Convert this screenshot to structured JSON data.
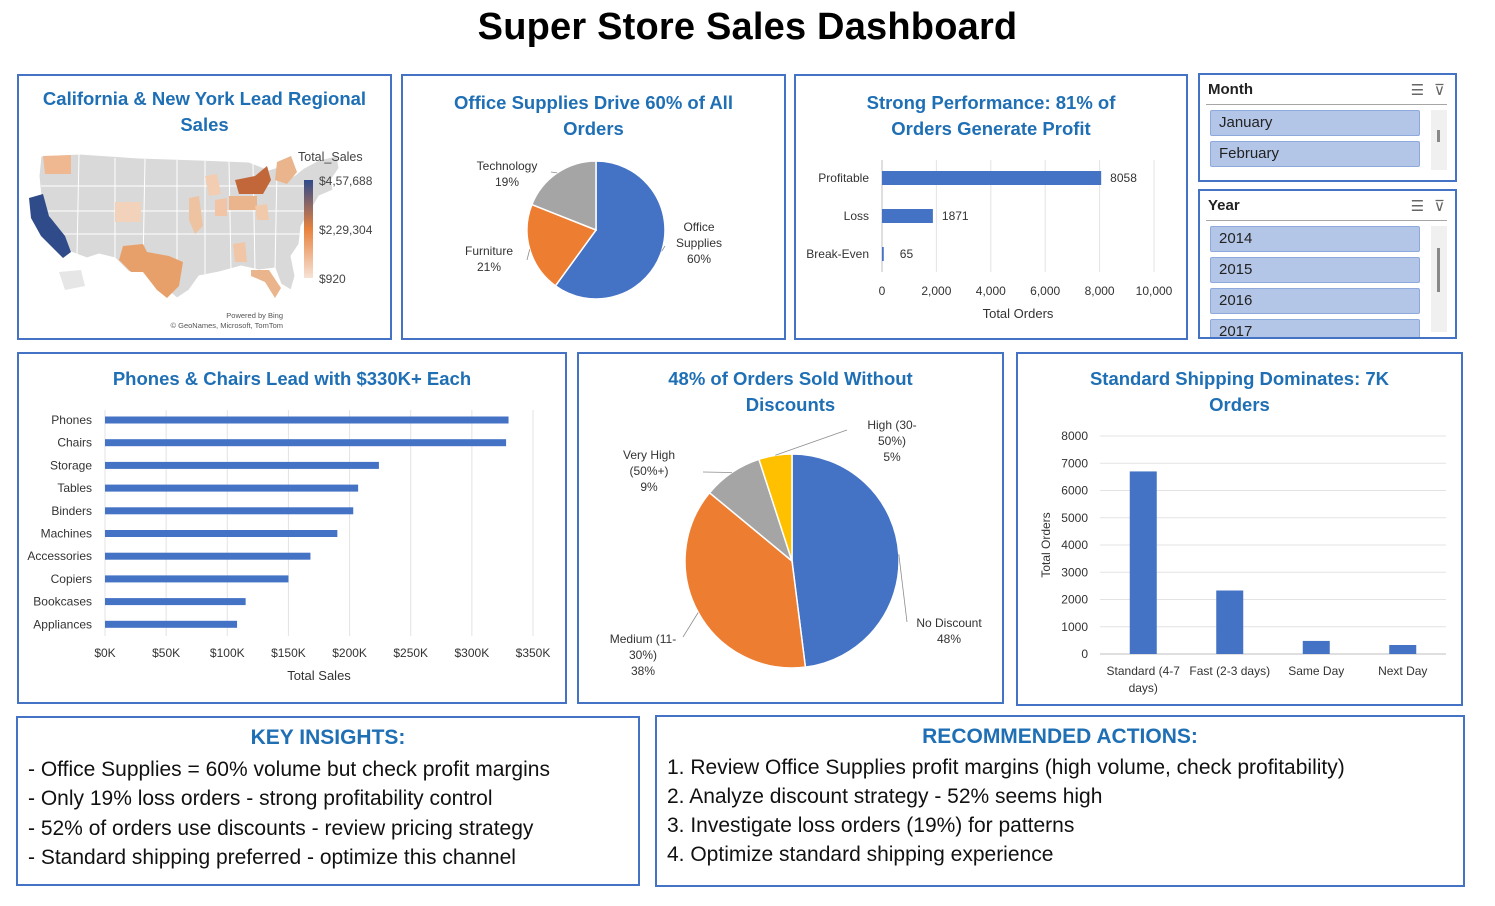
{
  "dashboard": {
    "title": "Super Store Sales Dashboard"
  },
  "map_panel": {
    "title_line1": "California & New York Lead Regional",
    "title_line2": "Sales",
    "legend_title": "Total_Sales",
    "legend_max": "$4,57,688",
    "legend_mid": "$2,29,304",
    "legend_min": "$920",
    "credit_line1": "Powered by Bing",
    "credit_line2": "© GeoNames, Microsoft, TomTom",
    "colors": {
      "high": "#2f4b8a",
      "mid": "#e8823e",
      "low": "#f3dcc8",
      "none": "#d9d9d9"
    }
  },
  "category_panel": {
    "title_line1": "Office Supplies Drive 60% of All",
    "title_line2": "Orders",
    "chart_data": {
      "type": "pie",
      "slices": [
        {
          "label": "Office Supplies",
          "label_lines": [
            "Office",
            "Supplies",
            "60%"
          ],
          "value": 60,
          "color": "#4472c4"
        },
        {
          "label": "Furniture",
          "label_lines": [
            "Furniture",
            "21%"
          ],
          "value": 21,
          "color": "#ed7d31"
        },
        {
          "label": "Technology",
          "label_lines": [
            "Technology",
            "19%"
          ],
          "value": 19,
          "color": "#a5a5a5"
        }
      ]
    }
  },
  "profit_panel": {
    "title_line1": "Strong Performance: 81% of",
    "title_line2": "Orders Generate Profit",
    "chart_data": {
      "type": "bar",
      "orientation": "horizontal",
      "categories": [
        "Profitable",
        "Loss",
        "Break-Even"
      ],
      "values": [
        8058,
        1871,
        65
      ],
      "value_labels": [
        "8058",
        "1871",
        "65"
      ],
      "xlim": [
        0,
        10000
      ],
      "ticks": [
        "0",
        "2,000",
        "4,000",
        "6,000",
        "8,000",
        "10,000"
      ],
      "xlabel": "Total Orders",
      "color": "#4472c4"
    }
  },
  "month_slicer": {
    "header": "Month",
    "items": [
      "January",
      "February"
    ]
  },
  "year_slicer": {
    "header": "Year",
    "items": [
      "2014",
      "2015",
      "2016",
      "2017"
    ]
  },
  "subcat_panel": {
    "title": "Phones & Chairs Lead with $330K+ Each",
    "chart_data": {
      "type": "bar",
      "orientation": "horizontal",
      "categories": [
        "Phones",
        "Chairs",
        "Storage",
        "Tables",
        "Binders",
        "Machines",
        "Accessories",
        "Copiers",
        "Bookcases",
        "Appliances"
      ],
      "values": [
        330000,
        328000,
        224000,
        207000,
        203000,
        190000,
        168000,
        150000,
        115000,
        108000
      ],
      "xlim": [
        0,
        350000
      ],
      "ticks": [
        "$0K",
        "$50K",
        "$100K",
        "$150K",
        "$200K",
        "$250K",
        "$300K",
        "$350K"
      ],
      "xlabel": "Total Sales",
      "color": "#4472c4"
    }
  },
  "discount_panel": {
    "title_line1": "48% of Orders Sold Without",
    "title_line2": "Discounts",
    "chart_data": {
      "type": "pie",
      "slices": [
        {
          "label": "No Discount",
          "label_lines": [
            "No Discount",
            "48%"
          ],
          "value": 48,
          "color": "#4472c4"
        },
        {
          "label": "Medium (11-30%)",
          "label_lines": [
            "Medium (11-",
            "30%)",
            "38%"
          ],
          "value": 38,
          "color": "#ed7d31"
        },
        {
          "label": "Very High (50%+)",
          "label_lines": [
            "Very High",
            "(50%+)",
            "9%"
          ],
          "value": 9,
          "color": "#a5a5a5"
        },
        {
          "label": "High (30-50%)",
          "label_lines": [
            "High (30-",
            "50%)",
            "5%"
          ],
          "value": 5,
          "color": "#ffc000"
        }
      ]
    }
  },
  "shipping_panel": {
    "title_line1": "Standard Shipping Dominates: 7K",
    "title_line2": "Orders",
    "chart_data": {
      "type": "bar",
      "orientation": "vertical",
      "categories": [
        "Standard (4-7 days)",
        "Fast (2-3 days)",
        "Same Day",
        "Next Day"
      ],
      "category_lines": [
        [
          "Standard (4-7",
          "days)"
        ],
        [
          "Fast (2-3 days)"
        ],
        [
          "Same Day"
        ],
        [
          "Next Day"
        ]
      ],
      "values": [
        6700,
        2330,
        480,
        330
      ],
      "ylim": [
        0,
        8000
      ],
      "yticks": [
        "0",
        "1000",
        "2000",
        "3000",
        "4000",
        "5000",
        "6000",
        "7000",
        "8000"
      ],
      "ylabel": "Total Orders",
      "color": "#4472c4"
    }
  },
  "insights": {
    "title": "KEY INSIGHTS:",
    "lines": [
      "- Office Supplies = 60% volume but check profit margins",
      "- Only 19% loss orders - strong profitability control",
      "- 52% of orders use discounts - review pricing strategy",
      "- Standard shipping preferred - optimize this channel"
    ]
  },
  "actions": {
    "title": "RECOMMENDED ACTIONS:",
    "lines": [
      "1. Review Office Supplies profit margins (high volume, check profitability)",
      "2. Analyze discount strategy - 52% seems high",
      "3. Investigate loss orders (19%) for patterns",
      "4. Optimize standard shipping experience"
    ]
  }
}
